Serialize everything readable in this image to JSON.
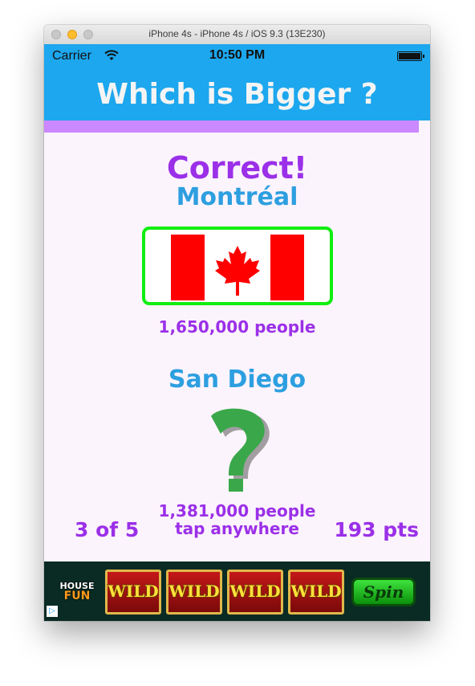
{
  "window": {
    "title": "iPhone 4s - iPhone 4s / iOS 9.3 (13E230)"
  },
  "status_bar": {
    "carrier": "Carrier",
    "time": "10:50 PM",
    "wifi_icon": "wifi-icon",
    "battery_icon": "battery-icon"
  },
  "nav": {
    "title": "Which is Bigger ?"
  },
  "progress": {
    "fraction": 0.97,
    "fill_color": "#cc88ff"
  },
  "game": {
    "result": "Correct!",
    "first": {
      "city": "Montréal",
      "population": "1,650,000 people",
      "flag": "canada-flag",
      "highlight_color": "#11ee11"
    },
    "second": {
      "city": "San Diego",
      "population": "1,381,000 people",
      "image": "question-mark-icon"
    },
    "tap_hint": "tap anywhere",
    "counter": "3 of 5",
    "score": "193 pts"
  },
  "ad": {
    "logo_line1": "HOUSE",
    "logo_line2": "FUN",
    "reels": [
      "WILD",
      "WILD",
      "WILD",
      "WILD"
    ],
    "spin_label": "Spin",
    "adchoices_icon": "adchoices-icon"
  },
  "colors": {
    "bar_blue": "#1da7ee",
    "accent_purple": "#9b30e8",
    "city_blue": "#2d9fe0",
    "background": "#fcf4fc"
  }
}
